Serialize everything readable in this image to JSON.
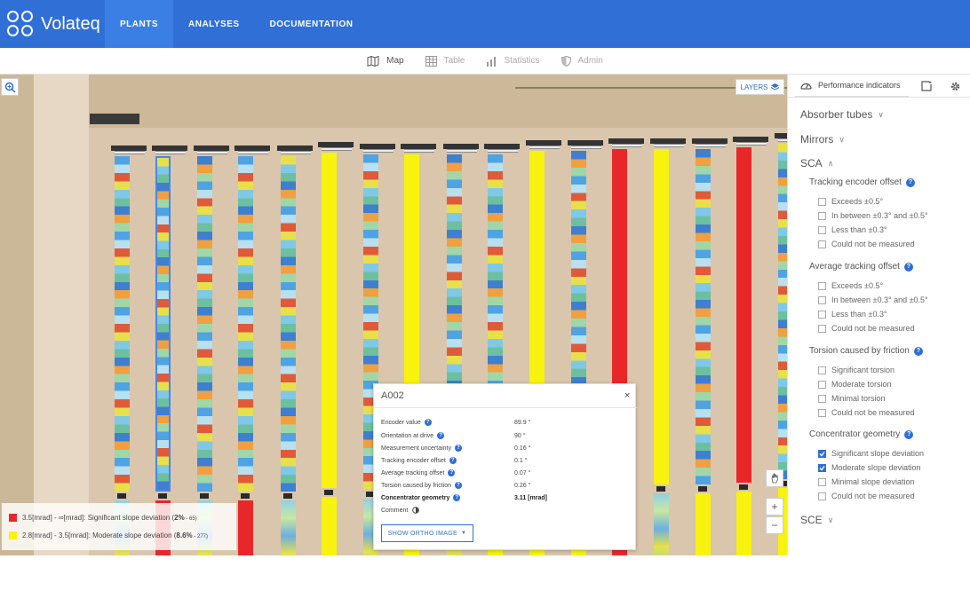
{
  "app": {
    "name": "Volateq",
    "nav": [
      {
        "label": "PLANTS",
        "active": true
      },
      {
        "label": "ANALYSES",
        "active": false
      },
      {
        "label": "DOCUMENTATION",
        "active": false
      }
    ]
  },
  "subnav": [
    {
      "label": "Map",
      "icon": "map-icon",
      "enabled": true
    },
    {
      "label": "Table",
      "icon": "table-icon",
      "enabled": false
    },
    {
      "label": "Statistics",
      "icon": "bar-chart-icon",
      "enabled": false
    },
    {
      "label": "Admin",
      "icon": "shield-icon",
      "enabled": false
    }
  ],
  "map": {
    "layers_label": "LAYERS",
    "legend": [
      {
        "color": "#e8272b",
        "text_prefix": "3.5[mrad] - ∞[mrad]: Significant slope deviation (",
        "percent": "2%",
        "count": " - 65)"
      },
      {
        "color": "#f7f30f",
        "text_prefix": "2.8[mrad] - 3.5[mrad]: Moderate slope deviation (",
        "percent": "8.6%",
        "count": " - 277)"
      }
    ]
  },
  "popup": {
    "title": "A002",
    "close": "×",
    "rows": [
      {
        "label": "Encoder value",
        "value": "89.9 °",
        "bold": false
      },
      {
        "label": "Orientation at drive",
        "value": "90 °",
        "bold": false
      },
      {
        "label": "Measurement uncertainty",
        "value": "0.16 °",
        "bold": false
      },
      {
        "label": "Tracking encoder offset",
        "value": "0.1 °",
        "bold": false
      },
      {
        "label": "Average tracking offset",
        "value": "0.07 °",
        "bold": false
      },
      {
        "label": "Torsion caused by friction",
        "value": "0.26 °",
        "bold": false
      },
      {
        "label": "Concentrator geometry",
        "value": "3.11 [mrad]",
        "bold": true
      }
    ],
    "comment_label": "Comment",
    "ortho_button": "SHOW ORTHO IMAGE"
  },
  "sidebar": {
    "tab": "Performance indicators",
    "sections": {
      "absorber": "Absorber tubes",
      "mirrors": "Mirrors",
      "sca": "SCA",
      "sce": "SCE"
    },
    "groups": [
      {
        "title": "Tracking encoder offset",
        "options": [
          {
            "label": "Exceeds ±0.5°",
            "checked": false
          },
          {
            "label": "In between ±0.3° and ±0.5°",
            "checked": false
          },
          {
            "label": "Less than ±0.3°",
            "checked": false
          },
          {
            "label": "Could not be measured",
            "checked": false
          }
        ]
      },
      {
        "title": "Average tracking offset",
        "options": [
          {
            "label": "Exceeds ±0.5°",
            "checked": false
          },
          {
            "label": "In between ±0.3° and ±0.5°",
            "checked": false
          },
          {
            "label": "Less than ±0.3°",
            "checked": false
          },
          {
            "label": "Could not be measured",
            "checked": false
          }
        ]
      },
      {
        "title": "Torsion caused by friction",
        "options": [
          {
            "label": "Significant torsion",
            "checked": false
          },
          {
            "label": "Moderate torsion",
            "checked": false
          },
          {
            "label": "Minimal torsion",
            "checked": false
          },
          {
            "label": "Could not be measured",
            "checked": false
          }
        ]
      },
      {
        "title": "Concentrator geometry",
        "options": [
          {
            "label": "Significant slope deviation",
            "checked": true
          },
          {
            "label": "Moderate slope deviation",
            "checked": true
          },
          {
            "label": "Minimal slope deviation",
            "checked": false
          },
          {
            "label": "Could not be measured",
            "checked": false
          }
        ]
      }
    ]
  },
  "colors": {
    "brand": "#2f6fd6",
    "significant": "#e8272b",
    "moderate": "#f7f30f"
  }
}
